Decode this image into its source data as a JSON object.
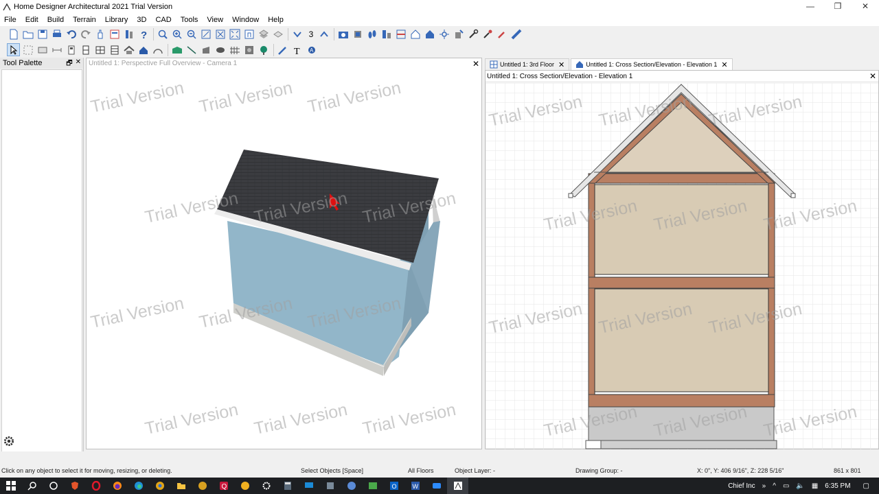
{
  "window": {
    "title": "Home Designer Architectural 2021 Trial Version",
    "controls": [
      "—",
      "❐",
      "✕"
    ]
  },
  "menu": [
    "File",
    "Edit",
    "Build",
    "Terrain",
    "Library",
    "3D",
    "CAD",
    "Tools",
    "View",
    "Window",
    "Help"
  ],
  "toolbar": {
    "floor_number": "3"
  },
  "tool_palette": {
    "title": "Tool Palette"
  },
  "view3d": {
    "title": "Untitled 1: Perspective Full Overview - Camera 1"
  },
  "tabs": [
    {
      "label": "Untitled 1: 3rd Floor",
      "active": false
    },
    {
      "label": "Untitled 1: Cross Section/Elevation - Elevation 1",
      "active": true
    }
  ],
  "elevation": {
    "title": "Untitled 1: Cross Section/Elevation - Elevation 1"
  },
  "watermark": "Trial Version",
  "status": {
    "hint": "Click on any object to select it for moving, resizing, or deleting.",
    "mode": "Select Objects [Space]",
    "floors": "All Floors",
    "object_layer": "Object Layer: -",
    "drawing_group": "Drawing Group: -",
    "coords": "X: 0\", Y: 406 9/16\", Z: 228 5/16\"",
    "size": "861 x 801"
  },
  "taskbar": {
    "user": "Chief Inc",
    "time": "6:35 PM"
  },
  "colors": {
    "roof": "#3a3b3e",
    "wall": "#92b6c9",
    "foundation": "#cfcfcb",
    "framing": "#b97f62",
    "interior": "#d8cbb4",
    "gable": "#ddd0bc"
  }
}
